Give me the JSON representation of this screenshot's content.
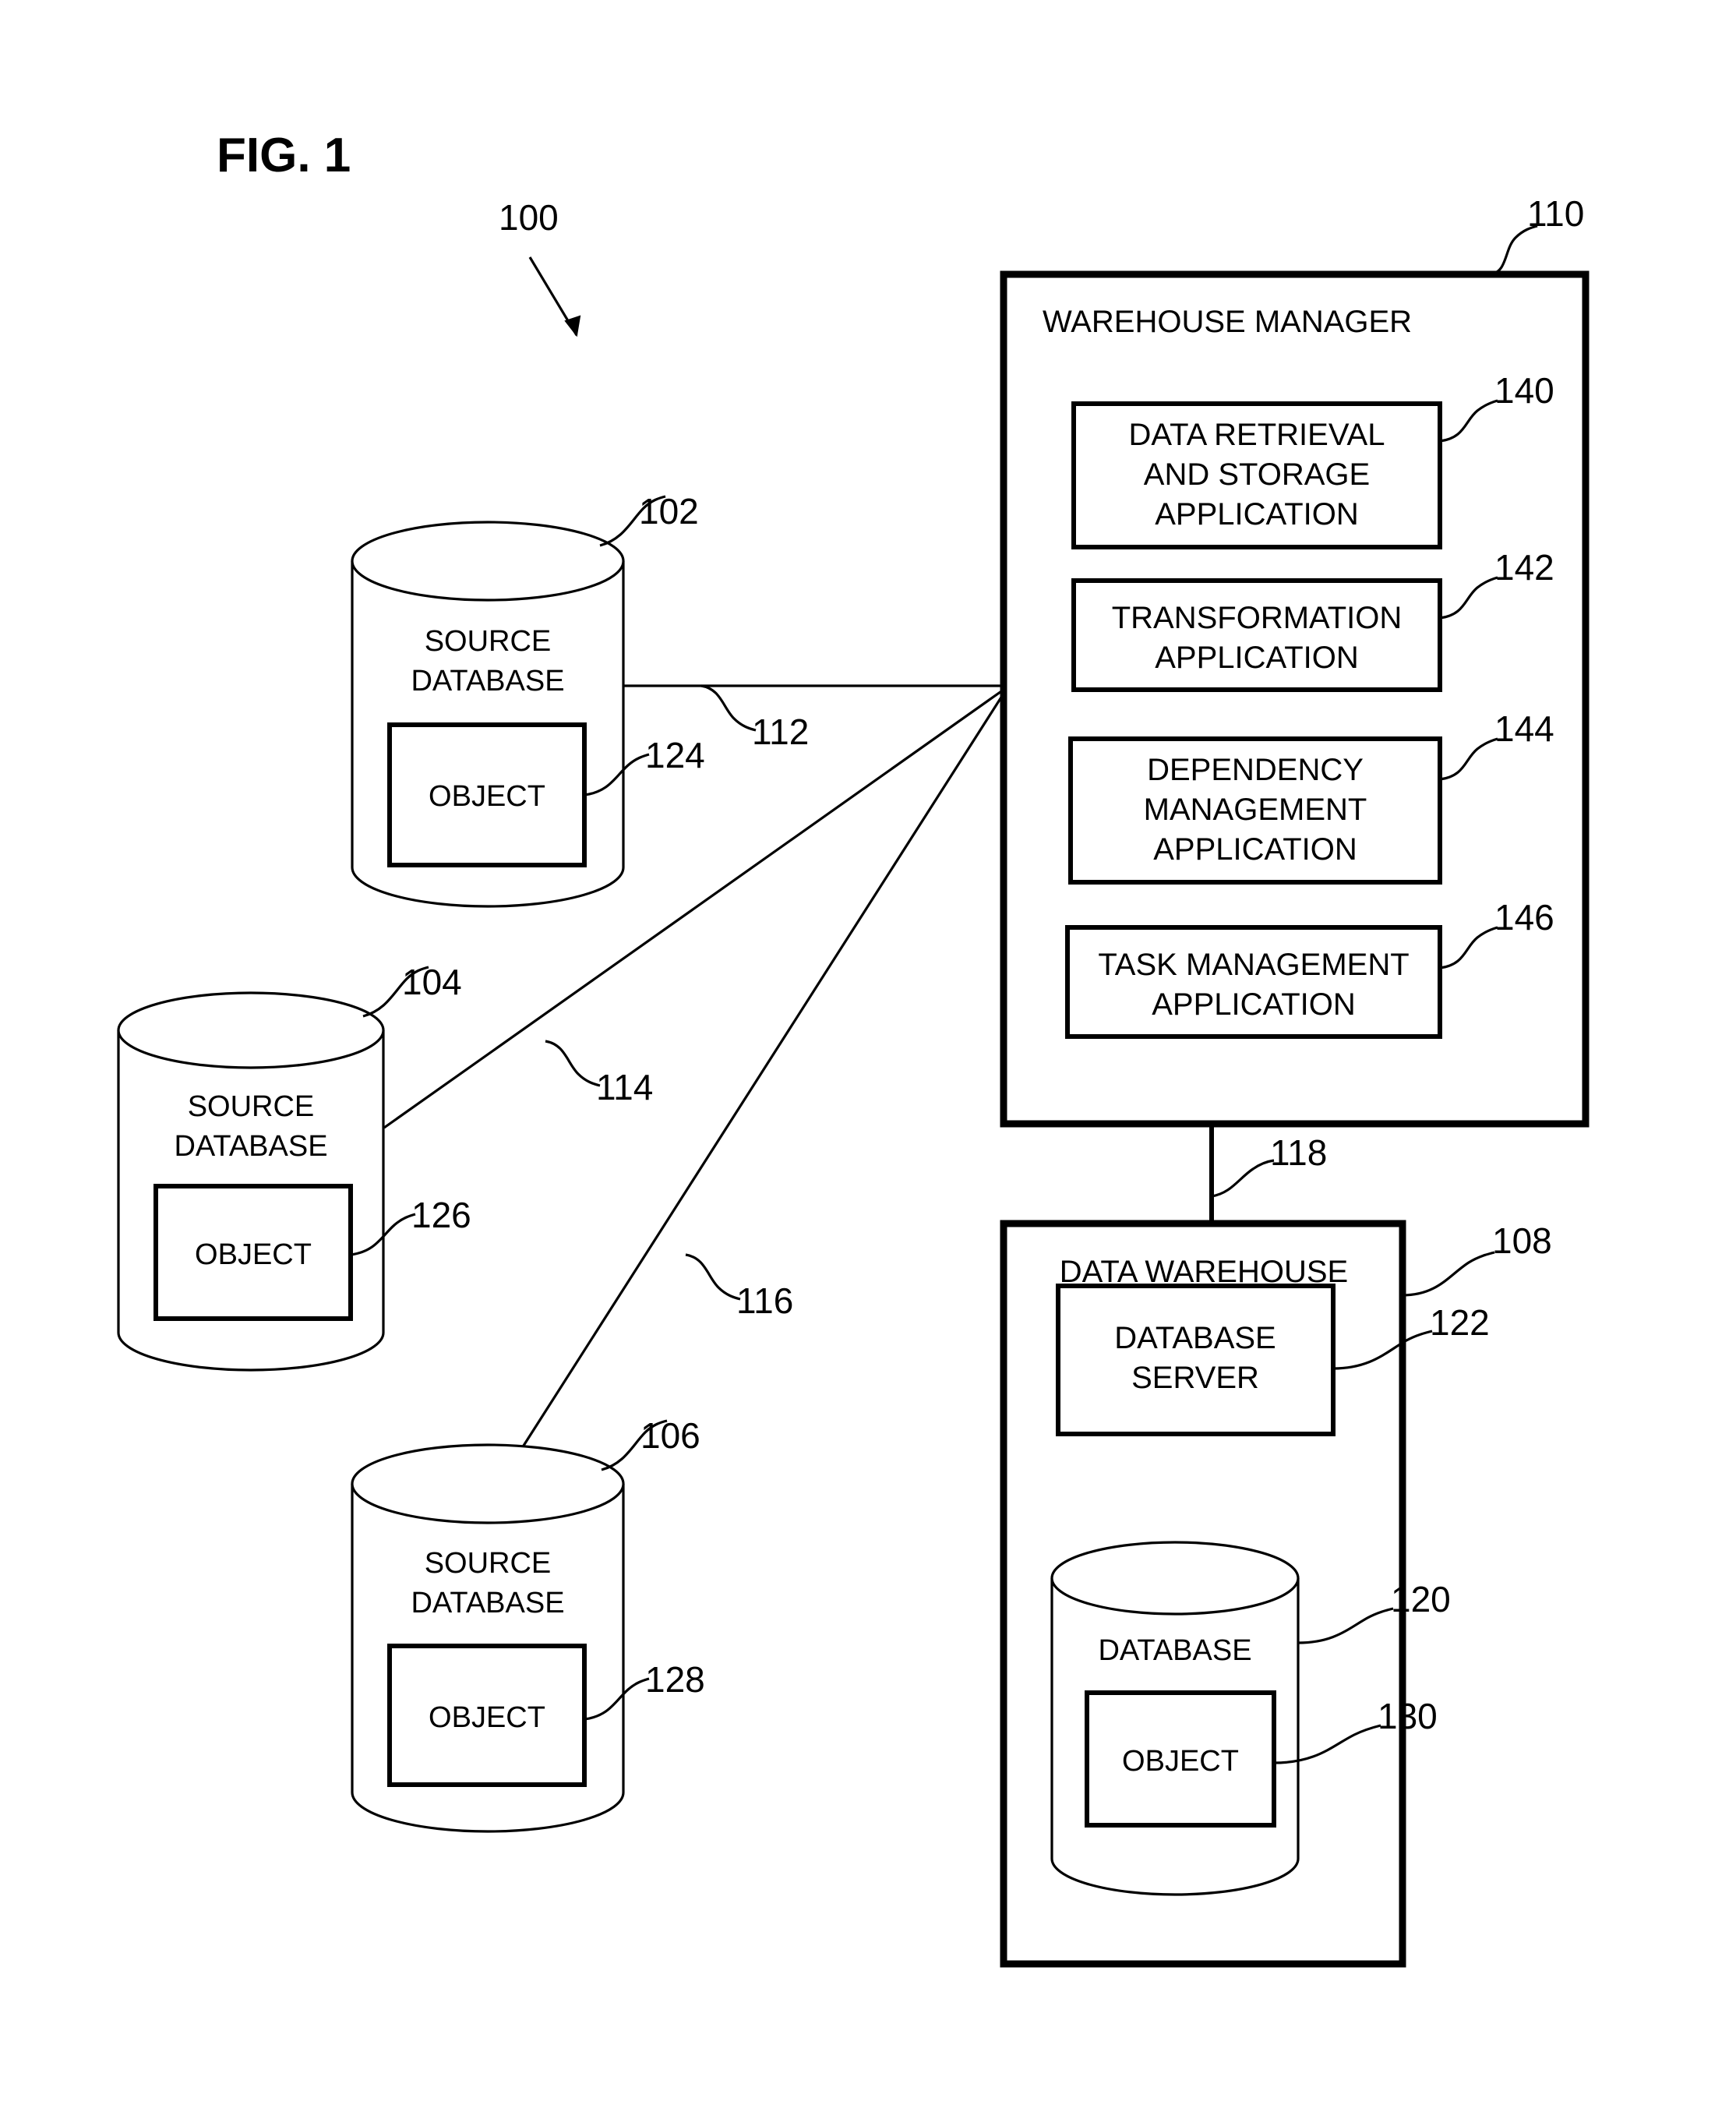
{
  "figure": {
    "title": "FIG. 1",
    "system_ref": "100"
  },
  "warehouse_manager": {
    "label": "WAREHOUSE MANAGER",
    "ref": "110",
    "applications": [
      {
        "label_lines": [
          "DATA RETRIEVAL",
          "AND STORAGE",
          "APPLICATION"
        ],
        "ref": "140"
      },
      {
        "label_lines": [
          "TRANSFORMATION",
          "APPLICATION"
        ],
        "ref": "142"
      },
      {
        "label_lines": [
          "DEPENDENCY",
          "MANAGEMENT",
          "APPLICATION"
        ],
        "ref": "144"
      },
      {
        "label_lines": [
          "TASK MANAGEMENT",
          "APPLICATION"
        ],
        "ref": "146"
      }
    ]
  },
  "source_databases": [
    {
      "label_lines": [
        "SOURCE",
        "DATABASE"
      ],
      "ref": "102",
      "object": {
        "label": "OBJECT",
        "ref": "124"
      },
      "connection": {
        "ref": "112"
      }
    },
    {
      "label_lines": [
        "SOURCE",
        "DATABASE"
      ],
      "ref": "104",
      "object": {
        "label": "OBJECT",
        "ref": "126"
      },
      "connection": {
        "ref": "114"
      }
    },
    {
      "label_lines": [
        "SOURCE",
        "DATABASE"
      ],
      "ref": "106",
      "object": {
        "label": "OBJECT",
        "ref": "128"
      },
      "connection": {
        "ref": "116"
      }
    }
  ],
  "data_warehouse": {
    "label": "DATA WAREHOUSE",
    "ref": "108",
    "connection": {
      "ref": "118"
    },
    "database_server": {
      "label_lines": [
        "DATABASE",
        "SERVER"
      ],
      "ref": "122"
    },
    "database": {
      "label": "DATABASE",
      "ref": "120",
      "object": {
        "label": "OBJECT",
        "ref": "130"
      }
    }
  },
  "colors": {
    "ink": "#000000",
    "paper": "#ffffff"
  }
}
